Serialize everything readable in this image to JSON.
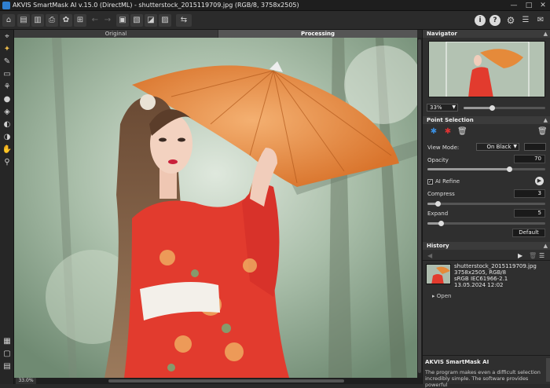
{
  "window": {
    "title": "AKVIS SmartMask AI v.15.0 (DirectML) - shutterstock_2015119709.jpg (RGB/8, 3758x2505)",
    "controls": [
      "—",
      "□",
      "✕"
    ]
  },
  "canvas": {
    "tabs": {
      "original": "Original",
      "processing": "Processing"
    },
    "zoom": "33.0%"
  },
  "navigator": {
    "header": "Navigator",
    "zoom": "33%",
    "zoom_fraction": 0.3
  },
  "point_selection": {
    "header": "Point Selection",
    "view_mode_label": "View Mode:",
    "view_mode_value": "On Black",
    "opacity_label": "Opacity",
    "opacity_value": "70",
    "ai_refine_label": "AI Refine",
    "compress_label": "Compress",
    "compress_value": "3",
    "expand_label": "Expand",
    "expand_value": "5",
    "default_button": "Default"
  },
  "history": {
    "header": "History",
    "item": {
      "name": "shutterstock_2015119709.jpg",
      "size": "3758x2505, RGB/8",
      "profile": "sRGB IEC61966-2.1",
      "date": "13.05.2024 12:02"
    },
    "open_label": "Open"
  },
  "about": {
    "title": "AKVIS SmartMask AI",
    "text": "The program makes even a difficult selection incredibly simple. The software provides powerful"
  },
  "colors": {
    "accent": "#e8b84a",
    "panel_bg": "#2f2f2f",
    "umbrella": "#e58a3a",
    "kimono": "#e23b2e"
  }
}
